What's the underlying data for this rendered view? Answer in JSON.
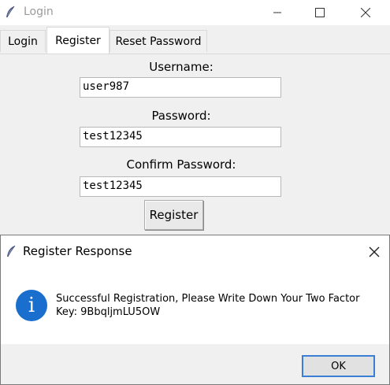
{
  "window": {
    "title": "Login",
    "minimize_icon": "minimize-icon",
    "maximize_icon": "maximize-icon",
    "close_icon": "close-icon"
  },
  "tabs": [
    {
      "label": "Login"
    },
    {
      "label": "Register"
    },
    {
      "label": "Reset Password"
    }
  ],
  "form": {
    "username_label": "Username:",
    "username_value": "user987",
    "password_label": "Password:",
    "password_value": "test12345",
    "confirm_label": "Confirm Password:",
    "confirm_value": "test12345",
    "register_button": "Register"
  },
  "dialog": {
    "title": "Register Response",
    "message": "Successful Registration, Please Write Down Your Two Factor Key: 9BbqljmLU5OW",
    "ok_label": "OK",
    "icon": "info-icon",
    "info_glyph": "i"
  },
  "colors": {
    "accent": "#1a6fce",
    "focus_border": "#3a7ed6"
  }
}
